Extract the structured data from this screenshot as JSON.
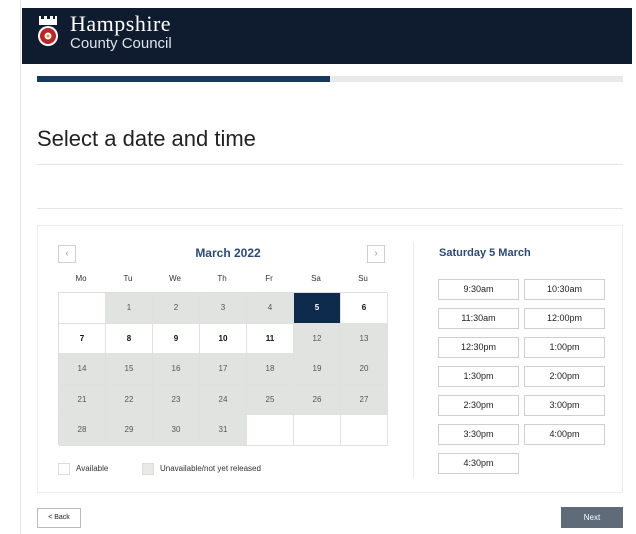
{
  "header": {
    "org_line1": "Hampshire",
    "org_line2": "County Council",
    "brand_color": "#0f1b2e",
    "crest_icon": "county-crest-icon"
  },
  "progress": {
    "fraction": 0.5
  },
  "page": {
    "title": "Select a date and time"
  },
  "calendar": {
    "month_label": "March 2022",
    "prev_icon": "chevron-left-icon",
    "next_icon": "chevron-right-icon",
    "weekdays": [
      "Mo",
      "Tu",
      "We",
      "Th",
      "Fr",
      "Sa",
      "Su"
    ],
    "weeks": [
      [
        {
          "day": "",
          "state": "empty"
        },
        {
          "day": "1",
          "state": "unavailable"
        },
        {
          "day": "2",
          "state": "unavailable"
        },
        {
          "day": "3",
          "state": "unavailable"
        },
        {
          "day": "4",
          "state": "unavailable"
        },
        {
          "day": "5",
          "state": "selected"
        },
        {
          "day": "6",
          "state": "available"
        }
      ],
      [
        {
          "day": "7",
          "state": "available"
        },
        {
          "day": "8",
          "state": "available"
        },
        {
          "day": "9",
          "state": "available"
        },
        {
          "day": "10",
          "state": "available"
        },
        {
          "day": "11",
          "state": "available"
        },
        {
          "day": "12",
          "state": "unavailable"
        },
        {
          "day": "13",
          "state": "unavailable"
        }
      ],
      [
        {
          "day": "14",
          "state": "unavailable"
        },
        {
          "day": "15",
          "state": "unavailable"
        },
        {
          "day": "16",
          "state": "unavailable"
        },
        {
          "day": "17",
          "state": "unavailable"
        },
        {
          "day": "18",
          "state": "unavailable"
        },
        {
          "day": "19",
          "state": "unavailable"
        },
        {
          "day": "20",
          "state": "unavailable"
        }
      ],
      [
        {
          "day": "21",
          "state": "unavailable"
        },
        {
          "day": "22",
          "state": "unavailable"
        },
        {
          "day": "23",
          "state": "unavailable"
        },
        {
          "day": "24",
          "state": "unavailable"
        },
        {
          "day": "25",
          "state": "unavailable"
        },
        {
          "day": "26",
          "state": "unavailable"
        },
        {
          "day": "27",
          "state": "unavailable"
        }
      ],
      [
        {
          "day": "28",
          "state": "unavailable"
        },
        {
          "day": "29",
          "state": "unavailable"
        },
        {
          "day": "30",
          "state": "unavailable"
        },
        {
          "day": "31",
          "state": "unavailable"
        },
        {
          "day": "",
          "state": "empty"
        },
        {
          "day": "",
          "state": "empty"
        },
        {
          "day": "",
          "state": "empty"
        }
      ]
    ],
    "legend": {
      "available": "Available",
      "unavailable": "Unavailable/not yet released"
    },
    "colors": {
      "selected": "#0e2a4d",
      "unavailable": "#e1e3e0"
    }
  },
  "times": {
    "day_title": "Saturday 5 March",
    "slots": [
      "9:30am",
      "10:30am",
      "11:30am",
      "12:00pm",
      "12:30pm",
      "1:00pm",
      "1:30pm",
      "2:00pm",
      "2:30pm",
      "3:00pm",
      "3:30pm",
      "4:00pm",
      "4:30pm"
    ]
  },
  "actions": {
    "back_label": "< Back",
    "next_label": "Next",
    "next_color": "#5f6b78"
  }
}
